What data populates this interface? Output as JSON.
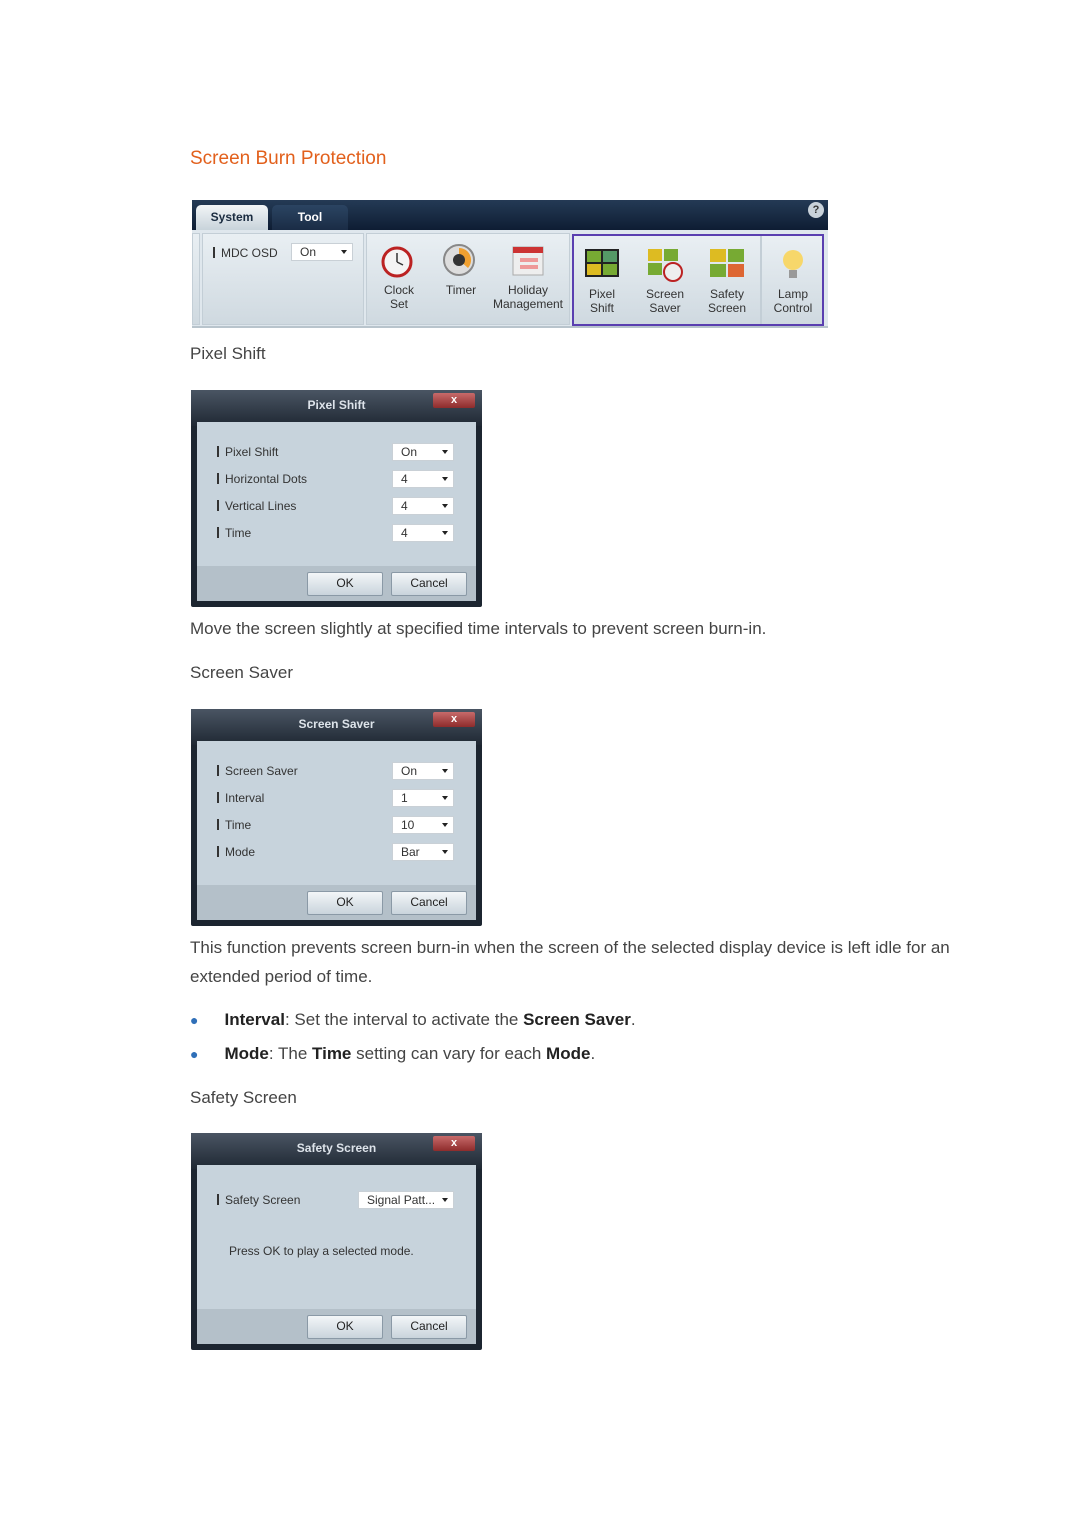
{
  "title": "Screen Burn Protection",
  "toolbar": {
    "tabs": [
      "System",
      "Tool"
    ],
    "help": "?",
    "mdc_osd_label": "MDC OSD",
    "mdc_osd_value": "On",
    "items": [
      {
        "label1": "Clock",
        "label2": "Set"
      },
      {
        "label1": "Timer",
        "label2": ""
      },
      {
        "label1": "Holiday",
        "label2": "Management"
      },
      {
        "label1": "Pixel",
        "label2": "Shift"
      },
      {
        "label1": "Screen",
        "label2": "Saver"
      },
      {
        "label1": "Safety",
        "label2": "Screen"
      },
      {
        "label1": "Lamp",
        "label2": "Control"
      }
    ],
    "highlight_color": "#5a3fb0"
  },
  "pixel_shift": {
    "heading": "Pixel Shift",
    "dialog_title": "Pixel Shift",
    "close": "x",
    "rows": [
      {
        "label": "Pixel Shift",
        "value": "On"
      },
      {
        "label": "Horizontal Dots",
        "value": "4"
      },
      {
        "label": "Vertical Lines",
        "value": "4"
      },
      {
        "label": "Time",
        "value": "4"
      }
    ],
    "ok": "OK",
    "cancel": "Cancel",
    "description": "Move the screen slightly at specified time intervals to prevent screen burn-in."
  },
  "screen_saver": {
    "heading": "Screen Saver",
    "dialog_title": "Screen Saver",
    "close": "x",
    "rows": [
      {
        "label": "Screen Saver",
        "value": "On"
      },
      {
        "label": "Interval",
        "value": "1"
      },
      {
        "label": "Time",
        "value": "10"
      },
      {
        "label": "Mode",
        "value": "Bar"
      }
    ],
    "ok": "OK",
    "cancel": "Cancel",
    "description": "This function prevents screen burn-in when the screen of the selected display device is left idle for an extended period of time.",
    "bullets": [
      {
        "term": "Interval",
        "text1": ": Set the interval to activate the ",
        "bold2": "Screen Saver",
        "text2": "."
      },
      {
        "term": "Mode",
        "text1": ": The ",
        "bold2": "Time",
        "text2": " setting can vary for each ",
        "bold3": "Mode",
        "text3": "."
      }
    ]
  },
  "safety_screen": {
    "heading": "Safety Screen",
    "dialog_title": "Safety Screen",
    "close": "x",
    "row_label": "Safety Screen",
    "row_value": "Signal Patt...",
    "message": "Press OK to play a selected mode.",
    "ok": "OK",
    "cancel": "Cancel"
  }
}
